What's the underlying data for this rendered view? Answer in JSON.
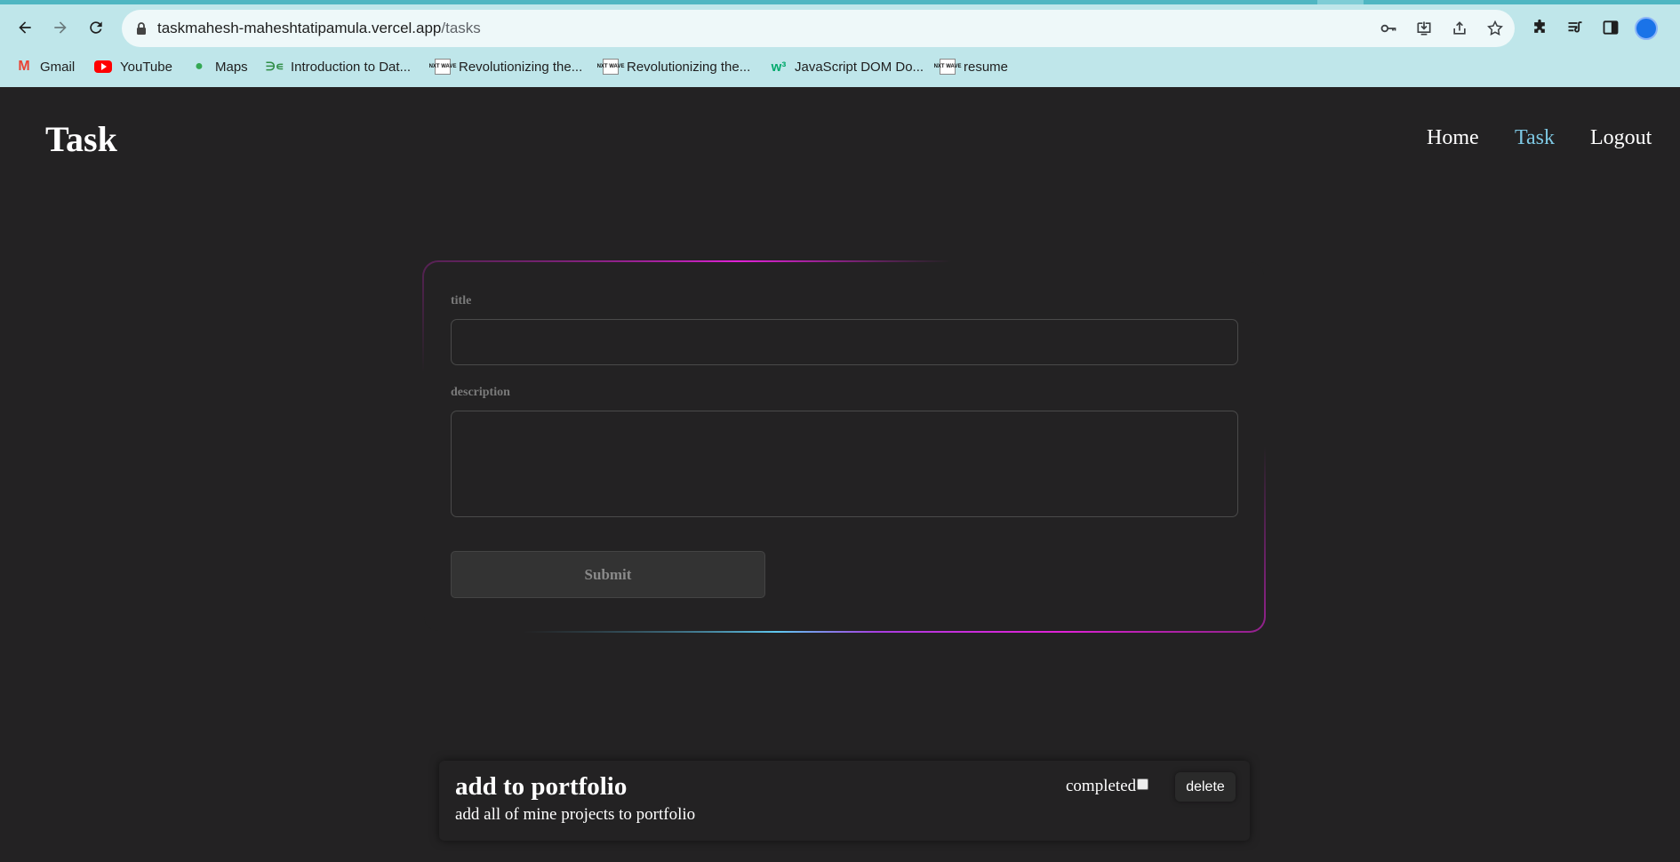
{
  "browser": {
    "url_host": "taskmahesh-maheshtatipamula.vercel.app",
    "url_path": "/tasks",
    "bookmarks": [
      {
        "label": "Gmail",
        "icon": "gmail-icon"
      },
      {
        "label": "YouTube",
        "icon": "youtube-icon"
      },
      {
        "label": "Maps",
        "icon": "maps-icon"
      },
      {
        "label": "Introduction to Dat...",
        "icon": "gfg-icon"
      },
      {
        "label": "Revolutionizing the...",
        "icon": "nxtwave-icon"
      },
      {
        "label": "Revolutionizing the...",
        "icon": "nxtwave-icon"
      },
      {
        "label": "JavaScript DOM Do...",
        "icon": "w3schools-icon"
      },
      {
        "label": "resume",
        "icon": "nxtwave-icon"
      }
    ],
    "nxt_favicon_text": "NXT WAVE"
  },
  "header": {
    "brand": "Task",
    "nav": [
      {
        "label": "Home",
        "active": false
      },
      {
        "label": "Task",
        "active": true
      },
      {
        "label": "Logout",
        "active": false
      }
    ]
  },
  "form": {
    "title_label": "title",
    "title_value": "",
    "description_label": "description",
    "description_value": "",
    "submit_label": "Submit"
  },
  "tasks": [
    {
      "title": "add to portfolio",
      "description": "add all of mine projects to portfolio",
      "completed_label": "completed",
      "completed": false,
      "delete_label": "delete"
    }
  ],
  "colors": {
    "page_bg": "#232223",
    "nav_active": "#7ec8e3",
    "border_pink": "#e022d6",
    "border_cyan": "#5fc8ef",
    "chrome_bg": "#bfe6ea"
  }
}
